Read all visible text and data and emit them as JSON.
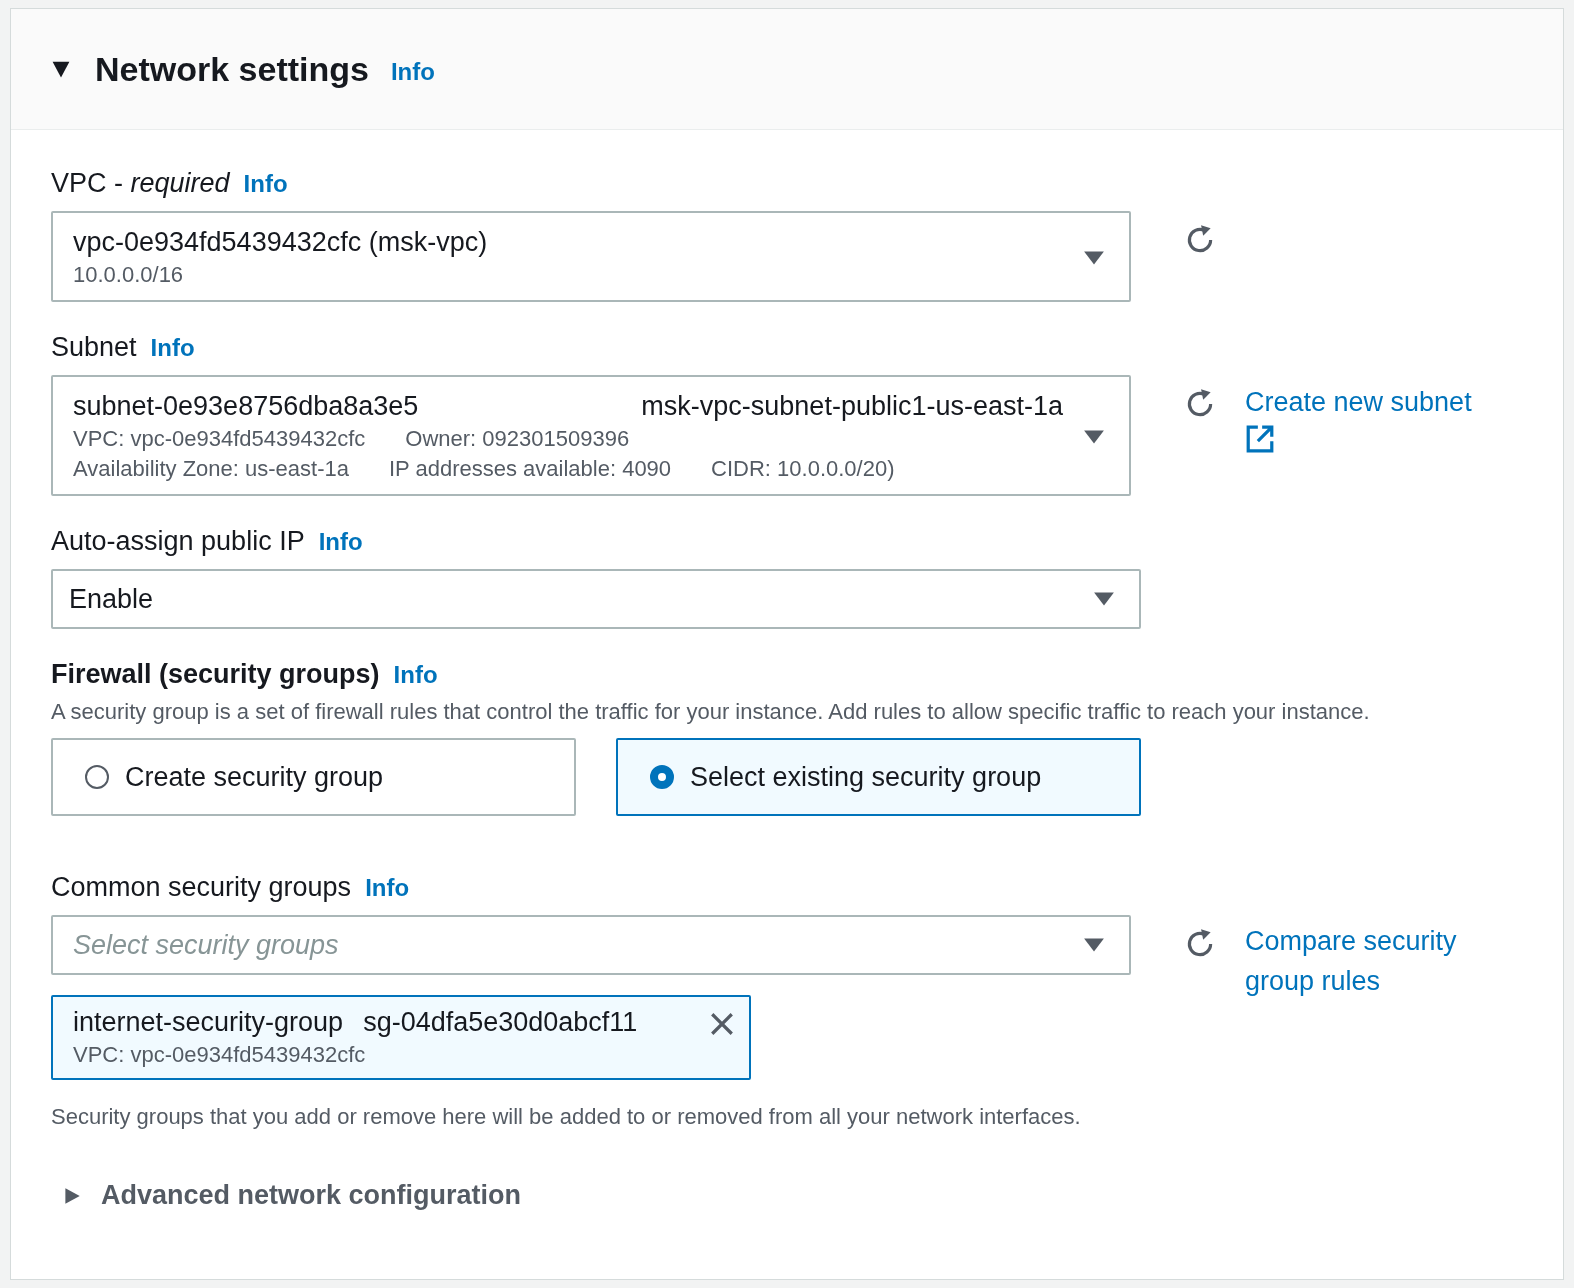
{
  "panel": {
    "title": "Network settings",
    "expanded": true,
    "info": "Info"
  },
  "vpc": {
    "label": "VPC -",
    "qualifier": "required",
    "info": "Info",
    "value": "vpc-0e934fd5439432cfc (msk-vpc)",
    "detail": "10.0.0.0/16"
  },
  "subnet": {
    "label": "Subnet",
    "info": "Info",
    "value": "subnet-0e93e8756dba8a3e5",
    "name": "msk-vpc-subnet-public1-us-east-1a",
    "detail_lines": [
      [
        "VPC: vpc-0e934fd5439432cfc",
        "Owner: 092301509396"
      ],
      [
        "Availability Zone: us-east-1a",
        "IP addresses available: 4090",
        "CIDR: 10.0.0.0/20)"
      ]
    ],
    "link": "Create new subnet"
  },
  "auto_assign": {
    "label": "Auto-assign public IP",
    "info": "Info",
    "value": "Enable"
  },
  "firewall": {
    "title": "Firewall (security groups)",
    "info": "Info",
    "description": "A security group is a set of firewall rules that control the traffic for your instance. Add rules to allow specific traffic to reach your instance.",
    "options": [
      {
        "label": "Create security group",
        "selected": false
      },
      {
        "label": "Select existing security group",
        "selected": true
      }
    ]
  },
  "common_groups": {
    "label": "Common security groups",
    "info": "Info",
    "placeholder": "Select security groups",
    "link": "Compare security group rules",
    "tokens": [
      {
        "name": "internet-security-group",
        "id": "sg-04dfa5e30d0abcf11",
        "vpc": "VPC: vpc-0e934fd5439432cfc"
      }
    ],
    "hint": "Security groups that you add or remove here will be added to or removed from all your network interfaces."
  },
  "advanced": {
    "title": "Advanced network configuration",
    "expanded": false
  }
}
